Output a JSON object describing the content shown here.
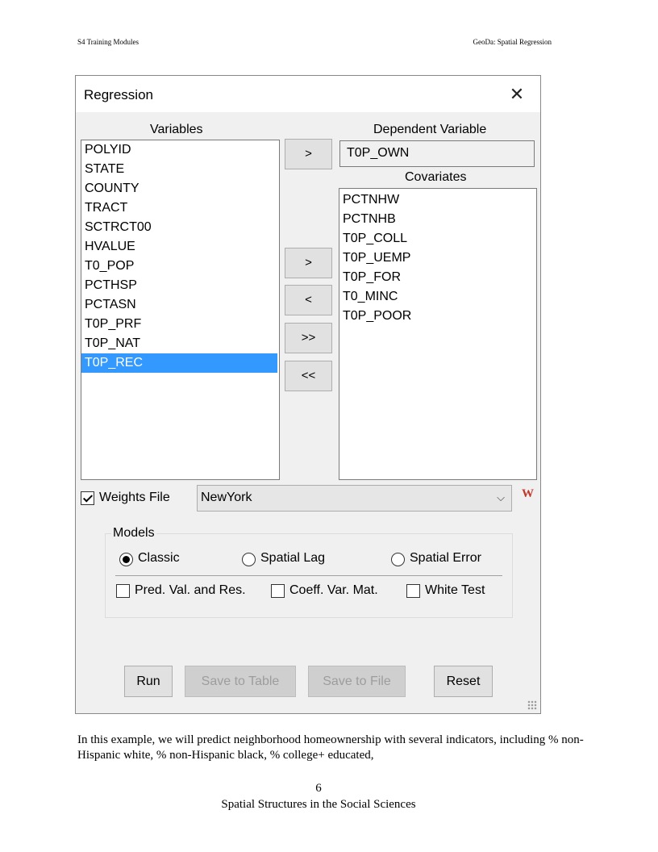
{
  "header": {
    "left": "S4 Training Modules",
    "right": "GeoDa: Spatial Regression"
  },
  "dialog": {
    "title": "Regression",
    "close_glyph": "✕",
    "variables_label": "Variables",
    "variables": [
      "POLYID",
      "STATE",
      "COUNTY",
      "TRACT",
      "SCTRCT00",
      "HVALUE",
      "T0_POP",
      "PCTHSP",
      "PCTASN",
      "T0P_PRF",
      "T0P_NAT",
      "T0P_REC"
    ],
    "selected_variable": "T0P_REC",
    "dependent_label": "Dependent Variable",
    "dependent_value": "T0P_OWN",
    "covariates_label": "Covariates",
    "covariates": [
      "PCTNHW",
      "PCTNHB",
      "T0P_COLL",
      "T0P_UEMP",
      "T0P_FOR",
      "T0_MINC",
      "T0P_POOR"
    ],
    "move_dep_btn": ">",
    "add_btn": ">",
    "remove_btn": "<",
    "add_all_btn": ">>",
    "remove_all_btn": "<<",
    "weights_label": "Weights File",
    "weights_checked": true,
    "weights_value": "NewYork",
    "chevron_glyph": "⌵",
    "weights_icon_glyph": "W",
    "models_label": "Models",
    "models": [
      "Classic",
      "Spatial Lag",
      "Spatial Error"
    ],
    "selected_model": "Classic",
    "options": [
      "Pred. Val. and Res.",
      "Coeff. Var. Mat.",
      "White Test"
    ],
    "buttons": {
      "run": "Run",
      "save_table": "Save to Table",
      "save_file": "Save to File",
      "reset": "Reset"
    }
  },
  "body_text": "In this example, we will predict neighborhood homeownership with several indicators, including % non-Hispanic white, % non-Hispanic black, % college+ educated,",
  "page_number": "6",
  "footer": "Spatial Structures in the Social Sciences",
  "colors": {
    "selection": "#3399ff",
    "dialog_bg": "#f0f0f0"
  }
}
